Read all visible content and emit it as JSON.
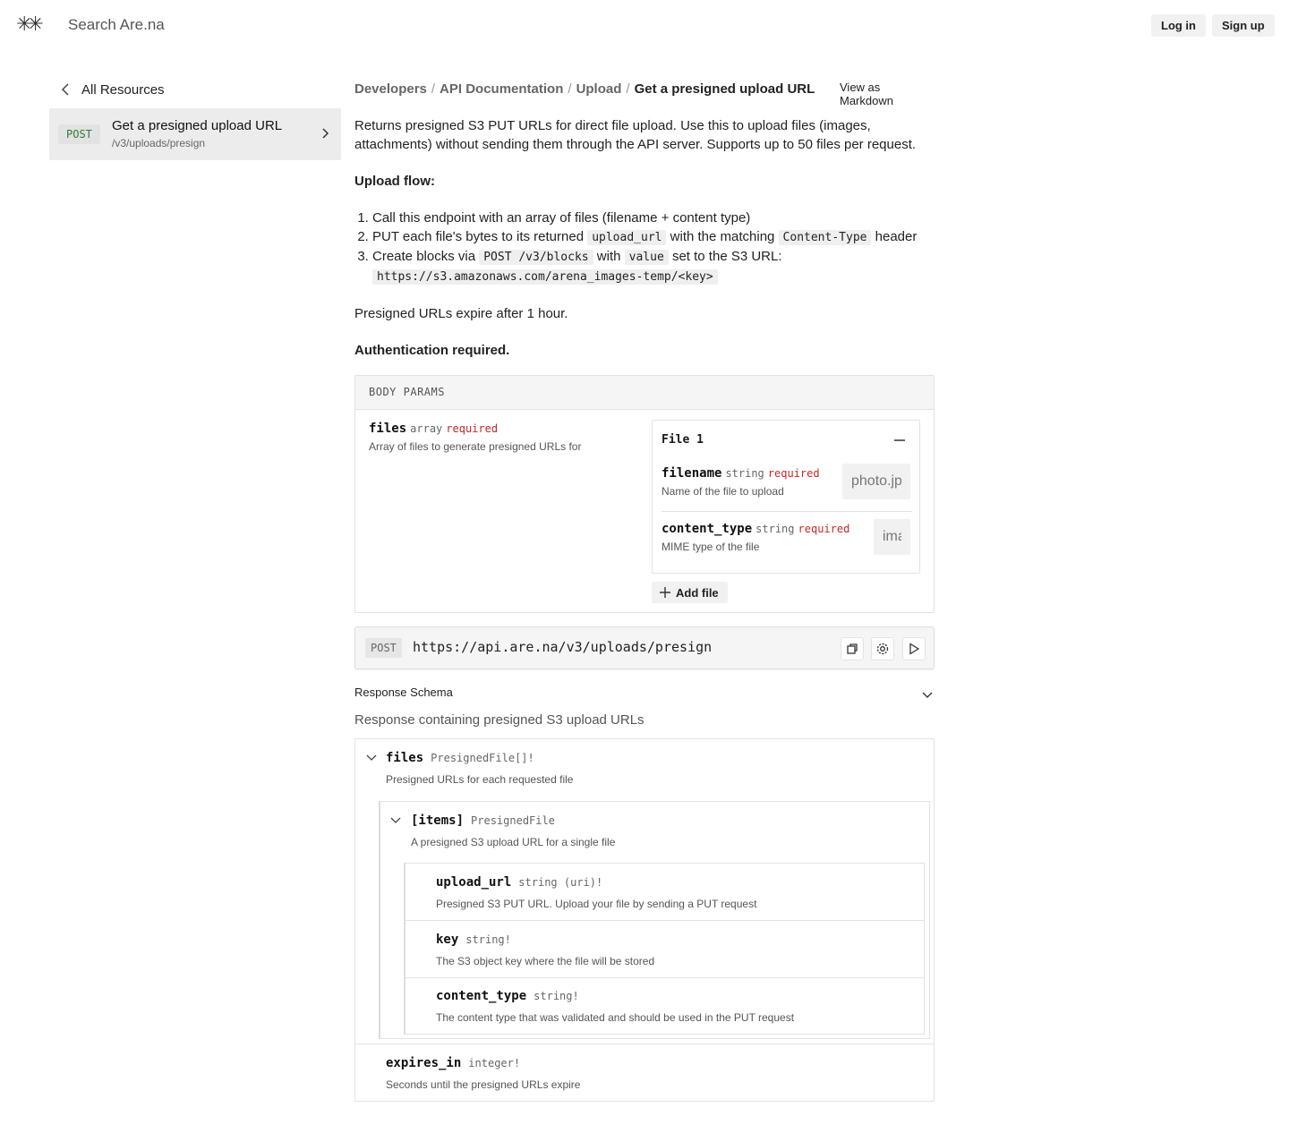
{
  "header": {
    "logo": "✳✳",
    "search_placeholder": "Search Are.na",
    "login_label": "Log in",
    "signup_label": "Sign up"
  },
  "sidebar": {
    "back_label": "All Resources",
    "items": [
      {
        "method": "POST",
        "title": "Get a presigned upload URL",
        "path": "/v3/uploads/presign"
      }
    ]
  },
  "breadcrumb": {
    "items": [
      "Developers",
      "API Documentation",
      "Upload"
    ],
    "current": "Get a presigned upload URL",
    "separator": "/"
  },
  "view_markdown_label": "View as Markdown",
  "description": {
    "intro": "Returns presigned S3 PUT URLs for direct file upload. Use this to upload files (images, attachments) without sending them through the API server. Supports up to 50 files per request.",
    "flow_heading": "Upload flow:",
    "step1": "Call this endpoint with an array of files (filename + content type)",
    "step2_a": "PUT each file's bytes to its returned ",
    "step2_code1": "upload_url",
    "step2_b": " with the matching ",
    "step2_code2": "Content-Type",
    "step2_c": " header",
    "step3_a": "Create blocks via ",
    "step3_code1": "POST /v3/blocks",
    "step3_b": " with ",
    "step3_code2": "value",
    "step3_c": " set to the S3 URL:",
    "step3_code3": "https://s3.amazonaws.com/arena_images-temp/<key>",
    "expiry": "Presigned URLs expire after 1 hour.",
    "auth": "Authentication required."
  },
  "body_params": {
    "heading": "BODY PARAMS",
    "files": {
      "name": "files",
      "type": "array",
      "required": "required",
      "desc": "Array of files to generate presigned URLs for"
    },
    "file_card": {
      "title": "File 1",
      "filename": {
        "name": "filename",
        "type": "string",
        "required": "required",
        "desc": "Name of the file to upload",
        "placeholder": "photo.jpg"
      },
      "content_type": {
        "name": "content_type",
        "type": "string",
        "required": "required",
        "desc": "MIME type of the file",
        "placeholder": "image/jpeg"
      }
    },
    "add_file_label": "Add file"
  },
  "request": {
    "method": "POST",
    "url": "https://api.are.na/v3/uploads/presign"
  },
  "response": {
    "heading": "Response Schema",
    "desc": "Response containing presigned S3 upload URLs",
    "files": {
      "name": "files",
      "type": "PresignedFile[]!",
      "desc": "Presigned URLs for each requested file"
    },
    "items": {
      "name": "[items]",
      "type": "PresignedFile",
      "desc": "A presigned S3 upload URL for a single file"
    },
    "fields": [
      {
        "name": "upload_url",
        "type": "string (uri)!",
        "desc": "Presigned S3 PUT URL. Upload your file by sending a PUT request"
      },
      {
        "name": "key",
        "type": "string!",
        "desc": "The S3 object key where the file will be stored"
      },
      {
        "name": "content_type",
        "type": "string!",
        "desc": "The content type that was validated and should be used in the PUT request"
      }
    ],
    "expires_in": {
      "name": "expires_in",
      "type": "integer!",
      "desc": "Seconds until the presigned URLs expire"
    }
  }
}
